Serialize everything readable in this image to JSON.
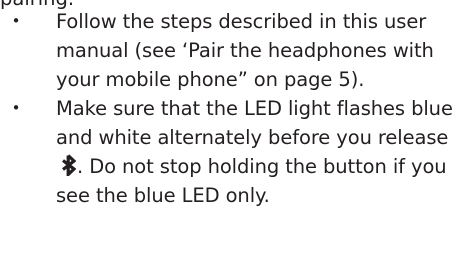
{
  "partial_line": "pairing.",
  "steps": [
    {
      "bullet": "•",
      "text": "Follow the steps described in this user manual  (see ‘Pair the headphones with your mobile phone” on page 5)."
    },
    {
      "bullet": "•",
      "text_before_icon": "Make sure that the LED light flashes blue and white alternately before you release",
      "icon": "bluetooth-icon",
      "text_after_icon": ". Do not stop holding the button if you see the blue LED only."
    }
  ],
  "colors": {
    "text": "#231f20"
  }
}
